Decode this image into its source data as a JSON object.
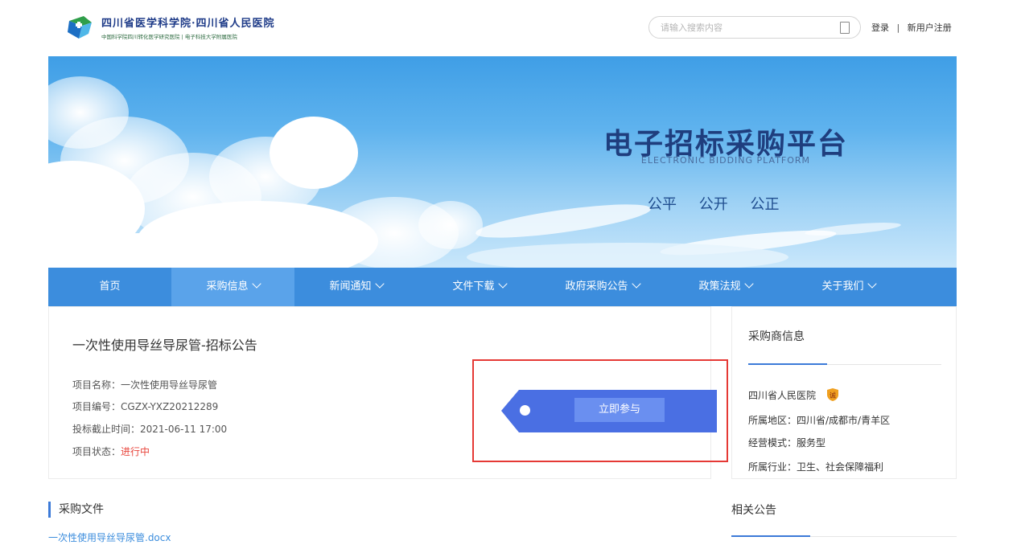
{
  "header": {
    "logo_title": "四川省医学科学院·四川省人民医院",
    "logo_subtitle": "中国科学院四川转化医学研究医院 | 电子科技大学附属医院",
    "search_placeholder": "请输入搜索内容",
    "login": "登录",
    "separator": "|",
    "register": "新用户注册"
  },
  "banner": {
    "title": "电子招标采购平台",
    "subtitle_en": "ELECTRONIC BIDDING PLATFORM",
    "slogans": [
      "公平",
      "公开",
      "公正"
    ]
  },
  "nav": {
    "items": [
      {
        "label": "首页",
        "dropdown": false,
        "active": false
      },
      {
        "label": "采购信息",
        "dropdown": true,
        "active": true
      },
      {
        "label": "新闻通知",
        "dropdown": true,
        "active": false
      },
      {
        "label": "文件下载",
        "dropdown": true,
        "active": false
      },
      {
        "label": "政府采购公告",
        "dropdown": true,
        "active": false
      },
      {
        "label": "政策法规",
        "dropdown": true,
        "active": false
      },
      {
        "label": "关于我们",
        "dropdown": true,
        "active": false
      }
    ]
  },
  "project": {
    "title": "一次性使用导丝导尿管-招标公告",
    "name_label": "项目名称：",
    "name_value": "一次性使用导丝导尿管",
    "code_label": "项目编号：",
    "code_value": "CGZX-YXZ20212289",
    "deadline_label": "投标截止时间：",
    "deadline_value": "2021-06-11 17:00",
    "status_label": "项目状态：",
    "status_value": "进行中",
    "join_button": "立即参与"
  },
  "buyer": {
    "title": "采购商信息",
    "name": "四川省人民医院",
    "badge_char": "诚",
    "region_label": "所属地区：",
    "region_value": "四川省/成都市/青羊区",
    "mode_label": "经营模式：",
    "mode_value": "服务型",
    "industry_label": "所属行业：",
    "industry_value": "卫生、社会保障福利"
  },
  "docs": {
    "heading": "采购文件",
    "file": "一次性使用导丝导尿管.docx"
  },
  "related": {
    "heading": "相关公告"
  },
  "colors": {
    "nav_bg": "#3c8ddd",
    "nav_active": "#5aa3ea",
    "ribbon": "#4a6fe3",
    "button": "#6a8ff0",
    "status": "#e8453c",
    "highlight": "#e53935",
    "accent": "#3c7ad8"
  }
}
